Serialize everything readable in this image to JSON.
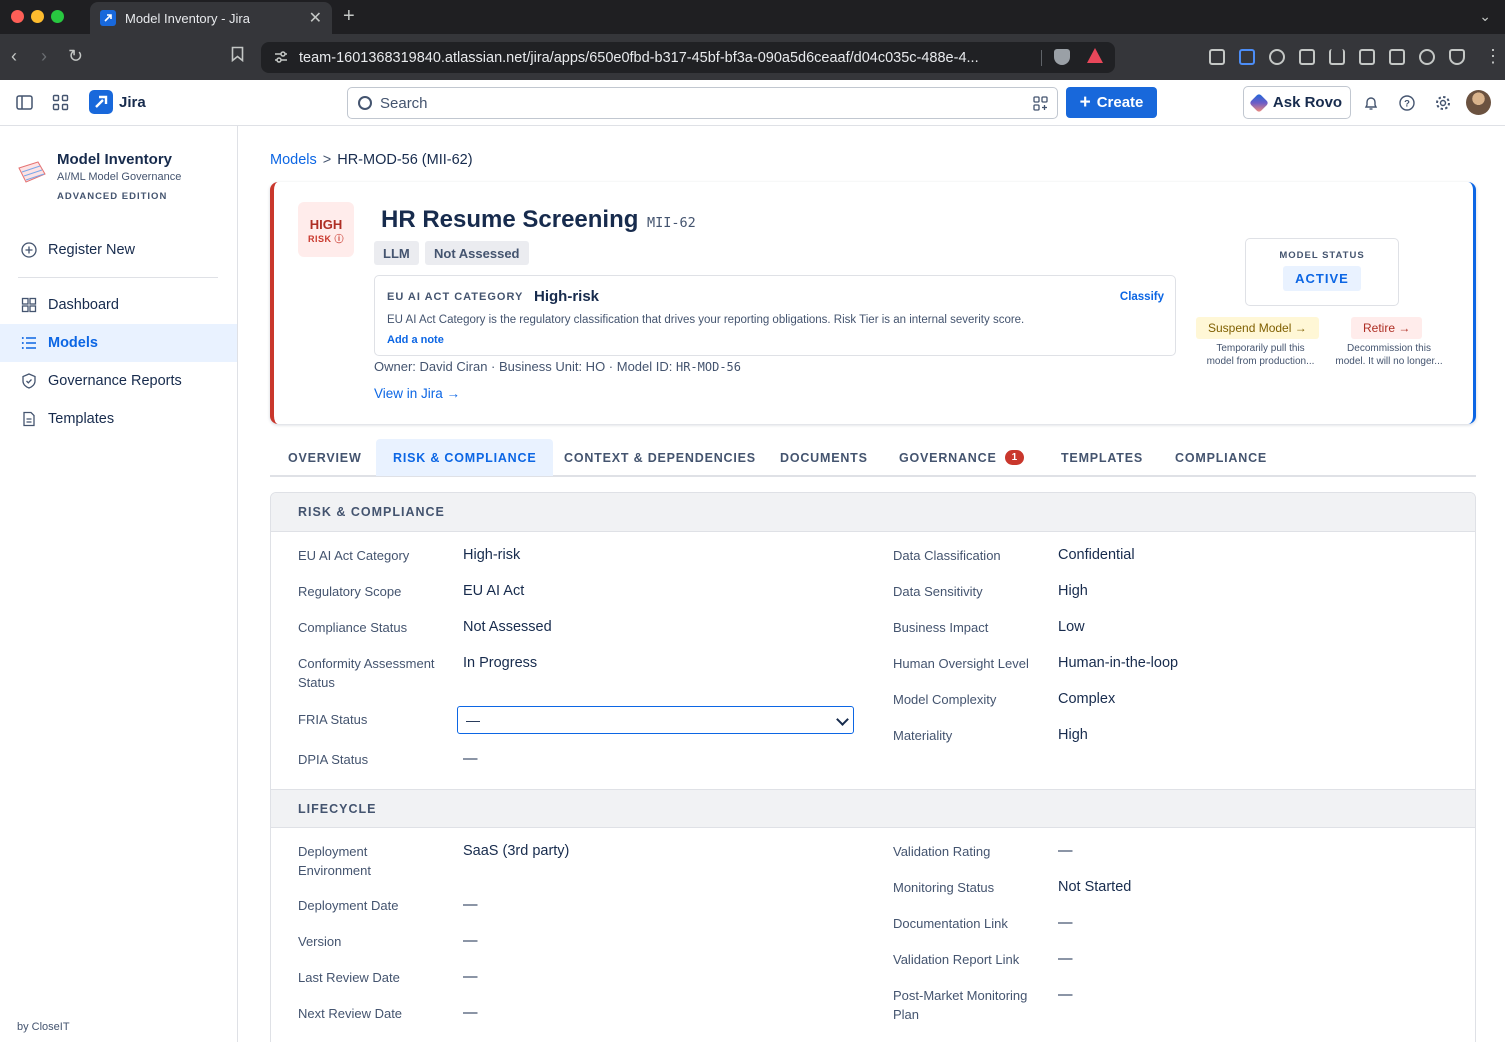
{
  "browser": {
    "tab_title": "Model Inventory - Jira",
    "url": "team-1601368319840.atlassian.net/jira/apps/650e0fbd-b317-45bf-bf3a-090a5d6ceaaf/d04c035c-488e-4..."
  },
  "topbar": {
    "product": "Jira",
    "search_placeholder": "Search",
    "create_label": "Create",
    "rovo_label": "Ask Rovo"
  },
  "sidebar": {
    "app_title": "Model Inventory",
    "app_subtitle": "AI/ML Model Governance",
    "edition": "ADVANCED EDITION",
    "register": "Register New",
    "items": [
      {
        "label": "Dashboard"
      },
      {
        "label": "Models"
      },
      {
        "label": "Governance Reports"
      },
      {
        "label": "Templates"
      }
    ],
    "footer": "by CloseIT"
  },
  "breadcrumb": {
    "root": "Models",
    "separator": ">",
    "current": "HR-MOD-56 (MII-62)"
  },
  "model": {
    "risk_level": "HIGH",
    "risk_label": "RISK ⓘ",
    "title": "HR Resume Screening",
    "key": "MII-62",
    "chips": [
      "LLM",
      "Not Assessed"
    ],
    "eu_label": "EU AI ACT CATEGORY",
    "eu_value": "High-risk",
    "classify": "Classify",
    "eu_desc": "EU AI Act Category is the regulatory classification that drives your reporting obligations. Risk Tier is an internal severity score.",
    "add_note": "Add a note",
    "owner_text": "Owner: David Ciran · Business Unit: HO · Model ID: ",
    "model_id": "HR-MOD-56",
    "view_in_jira": "View in Jira →",
    "status_label": "MODEL STATUS",
    "status_value": "ACTIVE",
    "suspend_label": "Suspend Model →",
    "suspend_desc_1": "Temporarily pull this",
    "suspend_desc_2": "model from production...",
    "retire_label": "Retire →",
    "retire_desc_1": "Decommission this",
    "retire_desc_2": "model. It will no longer..."
  },
  "tabs": [
    {
      "label": "OVERVIEW"
    },
    {
      "label": "RISK & COMPLIANCE"
    },
    {
      "label": "CONTEXT & DEPENDENCIES"
    },
    {
      "label": "DOCUMENTS"
    },
    {
      "label": "GOVERNANCE",
      "badge": "1"
    },
    {
      "label": "TEMPLATES"
    },
    {
      "label": "COMPLIANCE"
    }
  ],
  "risk_section": {
    "title": "RISK & COMPLIANCE",
    "left": [
      {
        "label": "EU AI Act Category",
        "value": "High-risk"
      },
      {
        "label": "Regulatory Scope",
        "value": "EU AI Act"
      },
      {
        "label": "Compliance Status",
        "value": "Not Assessed"
      },
      {
        "label": "Conformity Assessment Status",
        "value": "In Progress"
      },
      {
        "label": "FRIA Status",
        "value": "—"
      },
      {
        "label": "DPIA Status",
        "value": "—"
      }
    ],
    "right": [
      {
        "label": "Data Classification",
        "value": "Confidential"
      },
      {
        "label": "Data Sensitivity",
        "value": "High"
      },
      {
        "label": "Business Impact",
        "value": "Low"
      },
      {
        "label": "Human Oversight Level",
        "value": "Human-in-the-loop"
      },
      {
        "label": "Model Complexity",
        "value": "Complex"
      },
      {
        "label": "Materiality",
        "value": "High"
      }
    ]
  },
  "lifecycle_section": {
    "title": "LIFECYCLE",
    "left": [
      {
        "label": "Deployment Environment",
        "value": "SaaS (3rd party)"
      },
      {
        "label": "Deployment Date",
        "value": "—"
      },
      {
        "label": "Version",
        "value": "—"
      },
      {
        "label": "Last Review Date",
        "value": "—"
      },
      {
        "label": "Next Review Date",
        "value": "—"
      }
    ],
    "right": [
      {
        "label": "Validation Rating",
        "value": "—"
      },
      {
        "label": "Monitoring Status",
        "value": "Not Started"
      },
      {
        "label": "Documentation Link",
        "value": "—"
      },
      {
        "label": "Validation Report Link",
        "value": "—"
      },
      {
        "label": "Post-Market Monitoring Plan",
        "value": "—"
      }
    ]
  },
  "colors": {
    "accent": "#1868db",
    "risk_high": "#c9372c",
    "active_tab_bg": "#e9f2ff"
  }
}
